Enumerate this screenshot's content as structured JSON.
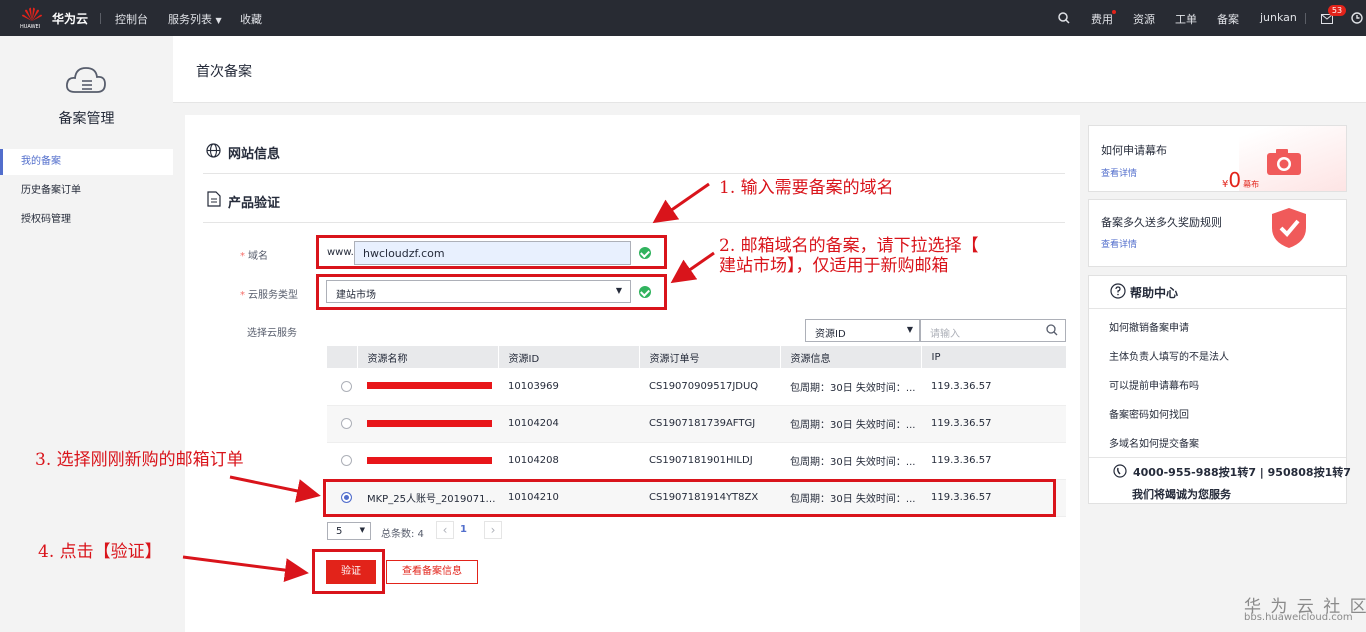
{
  "topbar": {
    "brand_small": "HUAWEI",
    "brand": "华为云",
    "nav": [
      "控制台",
      "服务列表",
      "收藏"
    ],
    "right": [
      "费用",
      "资源",
      "工单",
      "备案",
      "junkan"
    ],
    "badge": "53"
  },
  "sidebar": {
    "title": "备案管理",
    "items": [
      {
        "label": "我的备案",
        "active": true
      },
      {
        "label": "历史备案订单",
        "active": false
      },
      {
        "label": "授权码管理",
        "active": false
      }
    ]
  },
  "page": {
    "title": "首次备案"
  },
  "sections": {
    "website_info": "网站信息",
    "product_verify": "产品验证"
  },
  "form": {
    "domain_label": "域名",
    "domain_prefix": "www.",
    "domain_value": "hwcloudzf.com",
    "service_type_label": "云服务类型",
    "service_type_value": "建站市场",
    "select_service_label": "选择云服务",
    "search_field": "资源ID",
    "search_placeholder": "请输入"
  },
  "table": {
    "columns": [
      "资源名称",
      "资源ID",
      "资源订单号",
      "资源信息",
      "IP"
    ],
    "rows": [
      {
        "name": "",
        "redacted": true,
        "id": "10103969",
        "order": "CS19070909517JDUQ",
        "info": "包周期：30日 失效时间：...",
        "ip": "119.3.36.57",
        "selected": false
      },
      {
        "name": "",
        "redacted": true,
        "id": "10104204",
        "order": "CS1907181739AFTGJ",
        "info": "包周期：30日 失效时间：...",
        "ip": "119.3.36.57",
        "selected": false
      },
      {
        "name": "",
        "redacted": true,
        "id": "10104208",
        "order": "CS1907181901HILDJ",
        "info": "包周期：30日 失效时间：...",
        "ip": "119.3.36.57",
        "selected": false
      },
      {
        "name": "MKP_25人账号_20190718...",
        "redacted": false,
        "id": "10104210",
        "order": "CS1907181914YT8ZX",
        "info": "包周期：30日 失效时间：...",
        "ip": "119.3.36.57",
        "selected": true
      }
    ]
  },
  "pagination": {
    "page_size": "5",
    "total": "总条数: 4",
    "current": "1"
  },
  "buttons": {
    "verify": "验证",
    "view_record": "查看备案信息"
  },
  "annotations": {
    "a1": "1. 输入需要备案的域名",
    "a2_line1": "2. 邮箱域名的备案，请下拉选择【",
    "a2_line2": "建站市场】，仅适用于新购邮箱",
    "a3": "3. 选择刚刚新购的邮箱订单",
    "a4": "4. 点击【验证】"
  },
  "promo": [
    {
      "title": "如何申请幕布",
      "link": "查看详情",
      "price_symbol": "¥",
      "price": "0",
      "price_unit": "幕布"
    },
    {
      "title": "备案多久送多久奖励规则",
      "link": "查看详情"
    }
  ],
  "help": {
    "title": "帮助中心",
    "items": [
      "如何撤销备案申请",
      "主体负责人填写的不是法人",
      "可以提前申请幕布吗",
      "备案密码如何找回",
      "多域名如何提交备案"
    ],
    "phone": "4000-955-988按1转7 | 950808按1转7",
    "slogan": "我们将竭诚为您服务"
  },
  "watermark": {
    "line1": "华 为 云 社 区",
    "line2": "bbs.huaweicloud.com"
  },
  "colors": {
    "accent": "#526ecc",
    "danger": "#d9141b",
    "success": "#31b35e",
    "topbar": "#282b33"
  }
}
